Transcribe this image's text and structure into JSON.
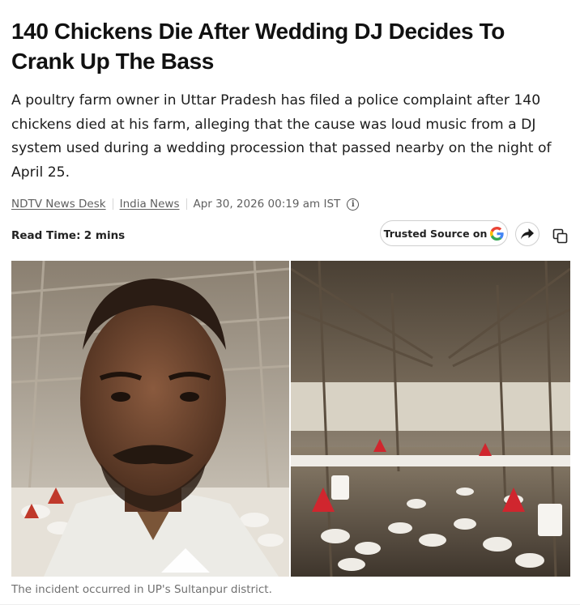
{
  "article": {
    "headline": "140 Chickens Die After Wedding DJ Decides To Crank Up The Bass",
    "summary": "A poultry farm owner in Uttar Pradesh has filed a police complaint after 140 chickens died at his farm, alleging that the cause was loud music from a DJ system used during a wedding procession that passed nearby on the night of April 25.",
    "author": "NDTV News Desk",
    "category": "India News",
    "date": "Apr 30, 2026 00:19 am IST",
    "read_time_label": "Read Time:",
    "read_time_value": "2 mins"
  },
  "actions": {
    "trusted_source_label": "Trusted Source on",
    "trusted_source_icon": "google-g-icon",
    "share_icon": "share-arrow-icon",
    "copy_icon": "copy-icon",
    "info_icon": "info-icon"
  },
  "media": {
    "caption": "The incident occurred in UP's Sultanpur district."
  },
  "colors": {
    "headline": "#111111",
    "meta_text": "#5f5f5f",
    "caption_text": "#707070",
    "google_blue": "#4285F4",
    "google_red": "#EA4335",
    "google_yellow": "#FBBC05",
    "google_green": "#34A853"
  }
}
